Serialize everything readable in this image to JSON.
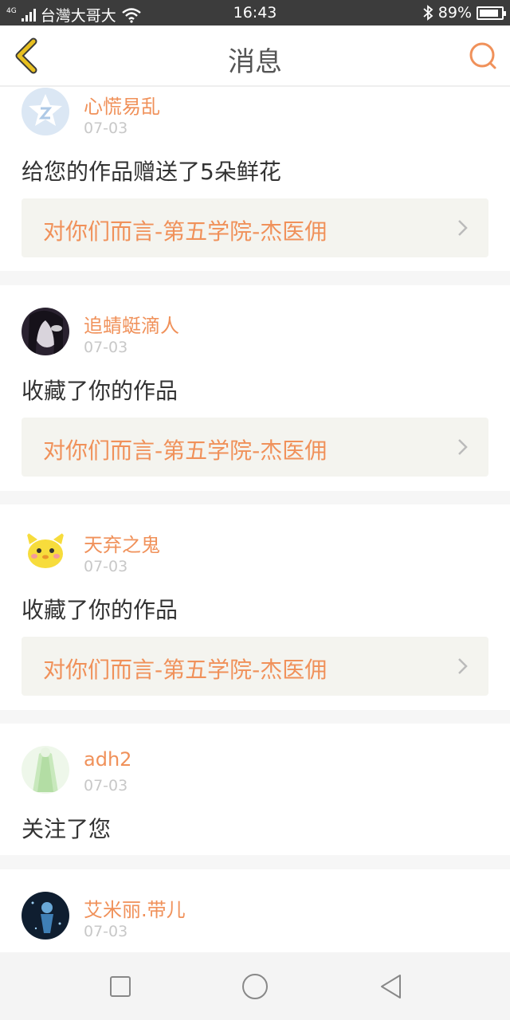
{
  "status_bar": {
    "network": "4G",
    "carrier": "台灣大哥大",
    "time": "16:43",
    "battery": "89%",
    "battery_level": 0.89,
    "icons": [
      "signal-icon",
      "wifi-icon",
      "bluetooth-icon",
      "battery-icon"
    ]
  },
  "header": {
    "title": "消息",
    "back_icon": "chevron-left-icon",
    "search_icon": "search-icon",
    "accent": "#f0915a",
    "back_color": "#e8c020"
  },
  "messages": [
    {
      "user": "心慌易乱",
      "date": "07-03",
      "action": "给您的作品赠送了5朵鲜花",
      "work": "对你们而言-第五学院-杰医佣",
      "avatar": "qq-default-avatar"
    },
    {
      "user": "追蜻蜓滴人",
      "date": "07-03",
      "action": "收藏了你的作品",
      "work": "对你们而言-第五学院-杰医佣",
      "avatar": "dark-hair-girl-avatar"
    },
    {
      "user": "天弃之鬼",
      "date": "07-03",
      "action": "收藏了你的作品",
      "work": "对你们而言-第五学院-杰医佣",
      "avatar": "yellow-chick-avatar"
    },
    {
      "user": "adh2",
      "date": "07-03",
      "action": "关注了您",
      "avatar": "green-dress-avatar"
    },
    {
      "user": "艾米丽.带儿",
      "date": "07-03",
      "avatar": "dark-blue-figure-avatar"
    }
  ],
  "nav_bar": {
    "recents_icon": "square-icon",
    "home_icon": "circle-icon",
    "back_icon": "triangle-back-icon"
  }
}
